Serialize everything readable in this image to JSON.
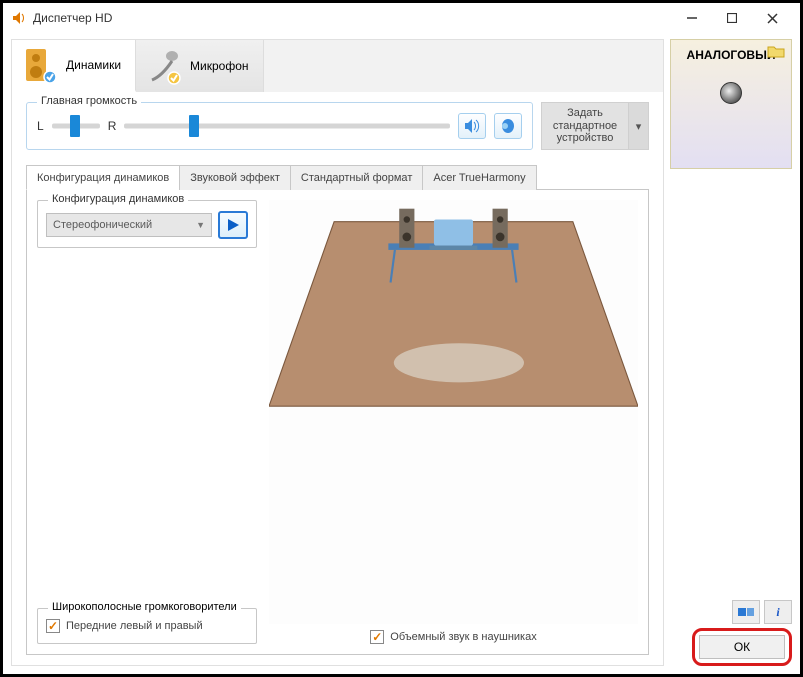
{
  "window": {
    "title": "Диспетчер HD"
  },
  "deviceTabs": [
    {
      "label": "Динамики",
      "active": true
    },
    {
      "label": "Микрофон",
      "active": false
    }
  ],
  "volume": {
    "groupLabel": "Главная громкость",
    "leftLabel": "L",
    "rightLabel": "R",
    "mainPositionPct": 20
  },
  "defaultDevice": {
    "text": "Задать стандартное устройство"
  },
  "subTabs": [
    {
      "label": "Конфигурация динамиков",
      "active": true
    },
    {
      "label": "Звуковой эффект",
      "active": false
    },
    {
      "label": "Стандартный формат",
      "active": false
    },
    {
      "label": "Acer TrueHarmony",
      "active": false
    }
  ],
  "speakerConfig": {
    "groupLabel": "Конфигурация динамиков",
    "selectValue": "Стереофонический"
  },
  "wideband": {
    "groupLabel": "Широкополосные громкоговорители",
    "optionLabel": "Передние левый и правый",
    "checked": true
  },
  "headphoneVirtual": {
    "label": "Объемный звук в наушниках",
    "checked": true
  },
  "sidePanel": {
    "analogLabel": "АНАЛОГОВЫЙ"
  },
  "okLabel": "ОК",
  "toolIcons": {
    "info": "i"
  }
}
